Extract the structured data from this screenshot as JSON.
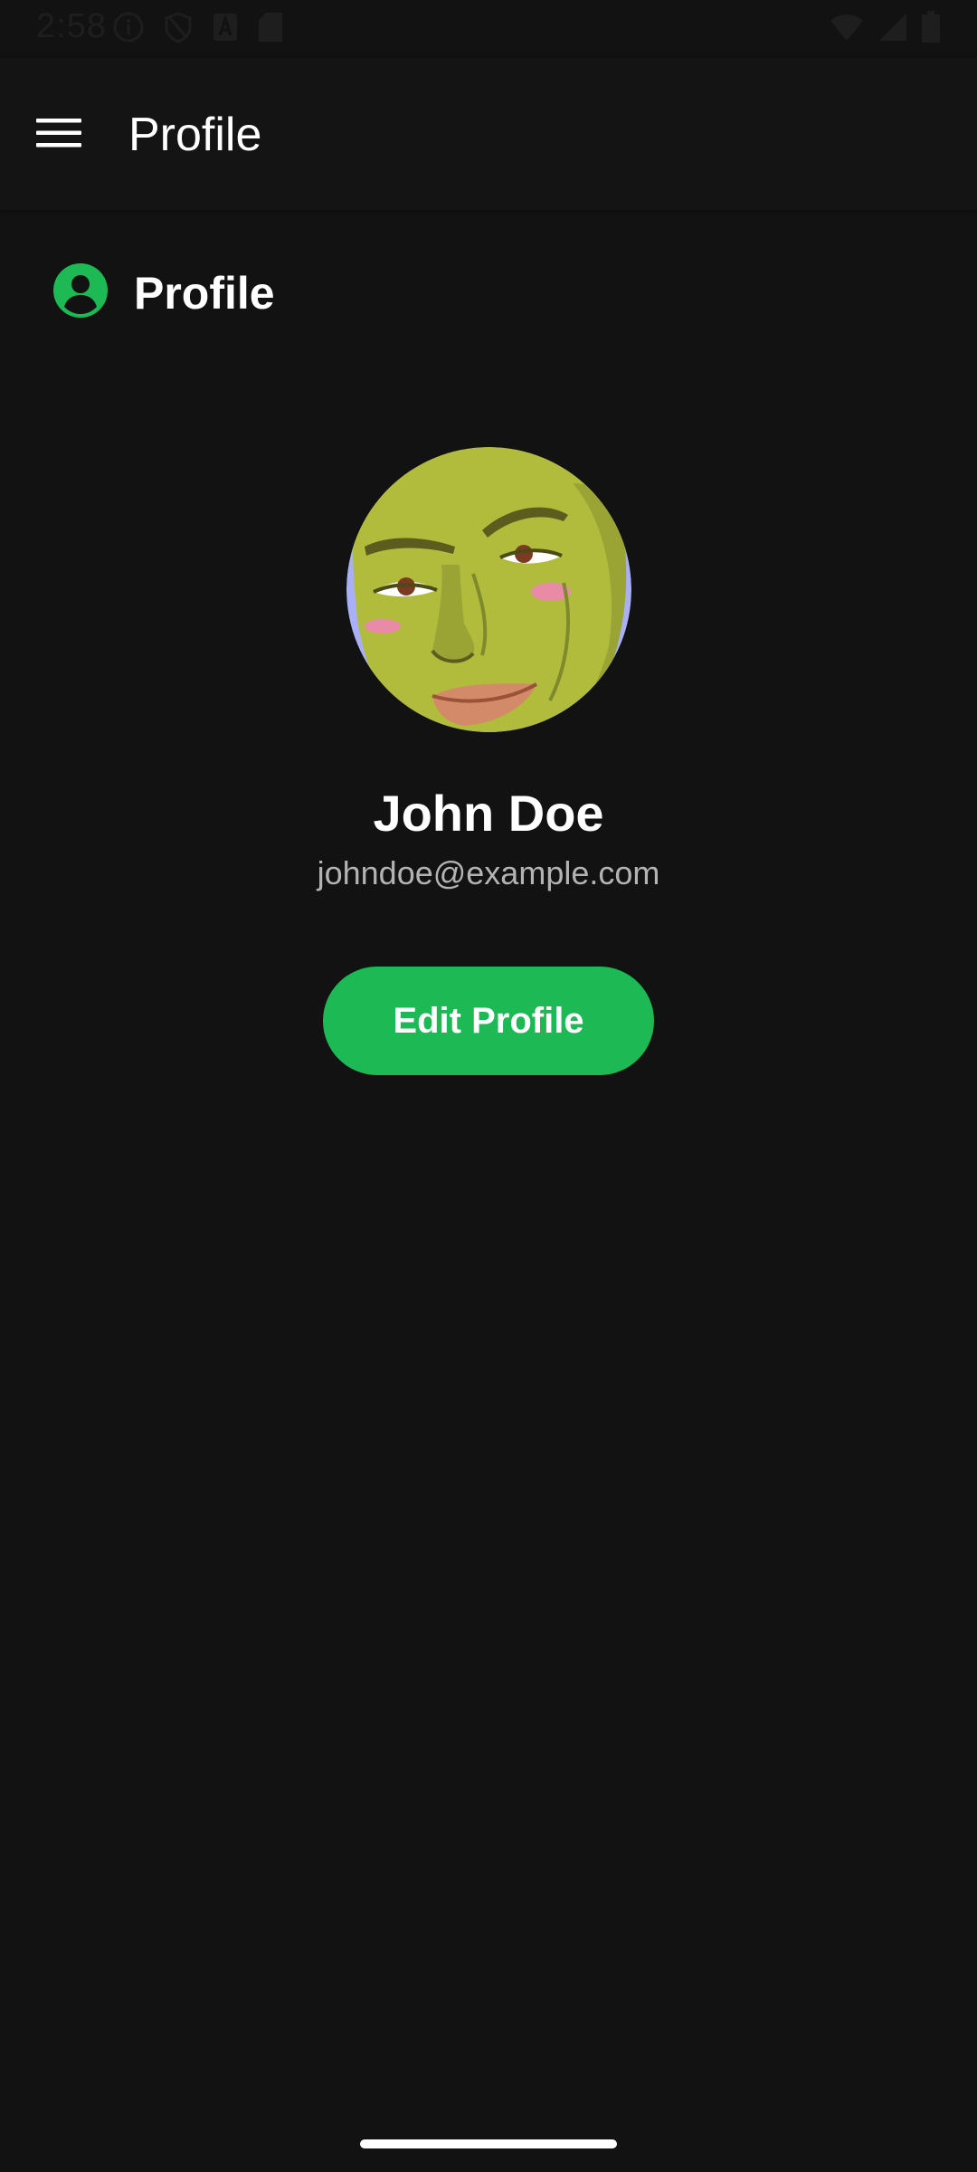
{
  "status_bar": {
    "time": "2:58",
    "left_icons": [
      "info-icon",
      "shield-icon",
      "a-icon",
      "sd-card-icon"
    ],
    "right_icons": [
      "wifi-icon",
      "signal-icon",
      "battery-icon"
    ]
  },
  "app_bar": {
    "title": "Profile",
    "menu_icon": "hamburger-menu-icon"
  },
  "section": {
    "title": "Profile",
    "icon": "account-circle-icon"
  },
  "profile": {
    "name": "John Doe",
    "email": "johndoe@example.com",
    "avatar_icon": "cartoon-face-avatar"
  },
  "actions": {
    "edit_label": "Edit Profile"
  },
  "colors": {
    "background": "#121212",
    "app_bar": "#141414",
    "accent": "#1db954",
    "text_primary": "#ffffff",
    "text_secondary": "#b3b3b3"
  }
}
